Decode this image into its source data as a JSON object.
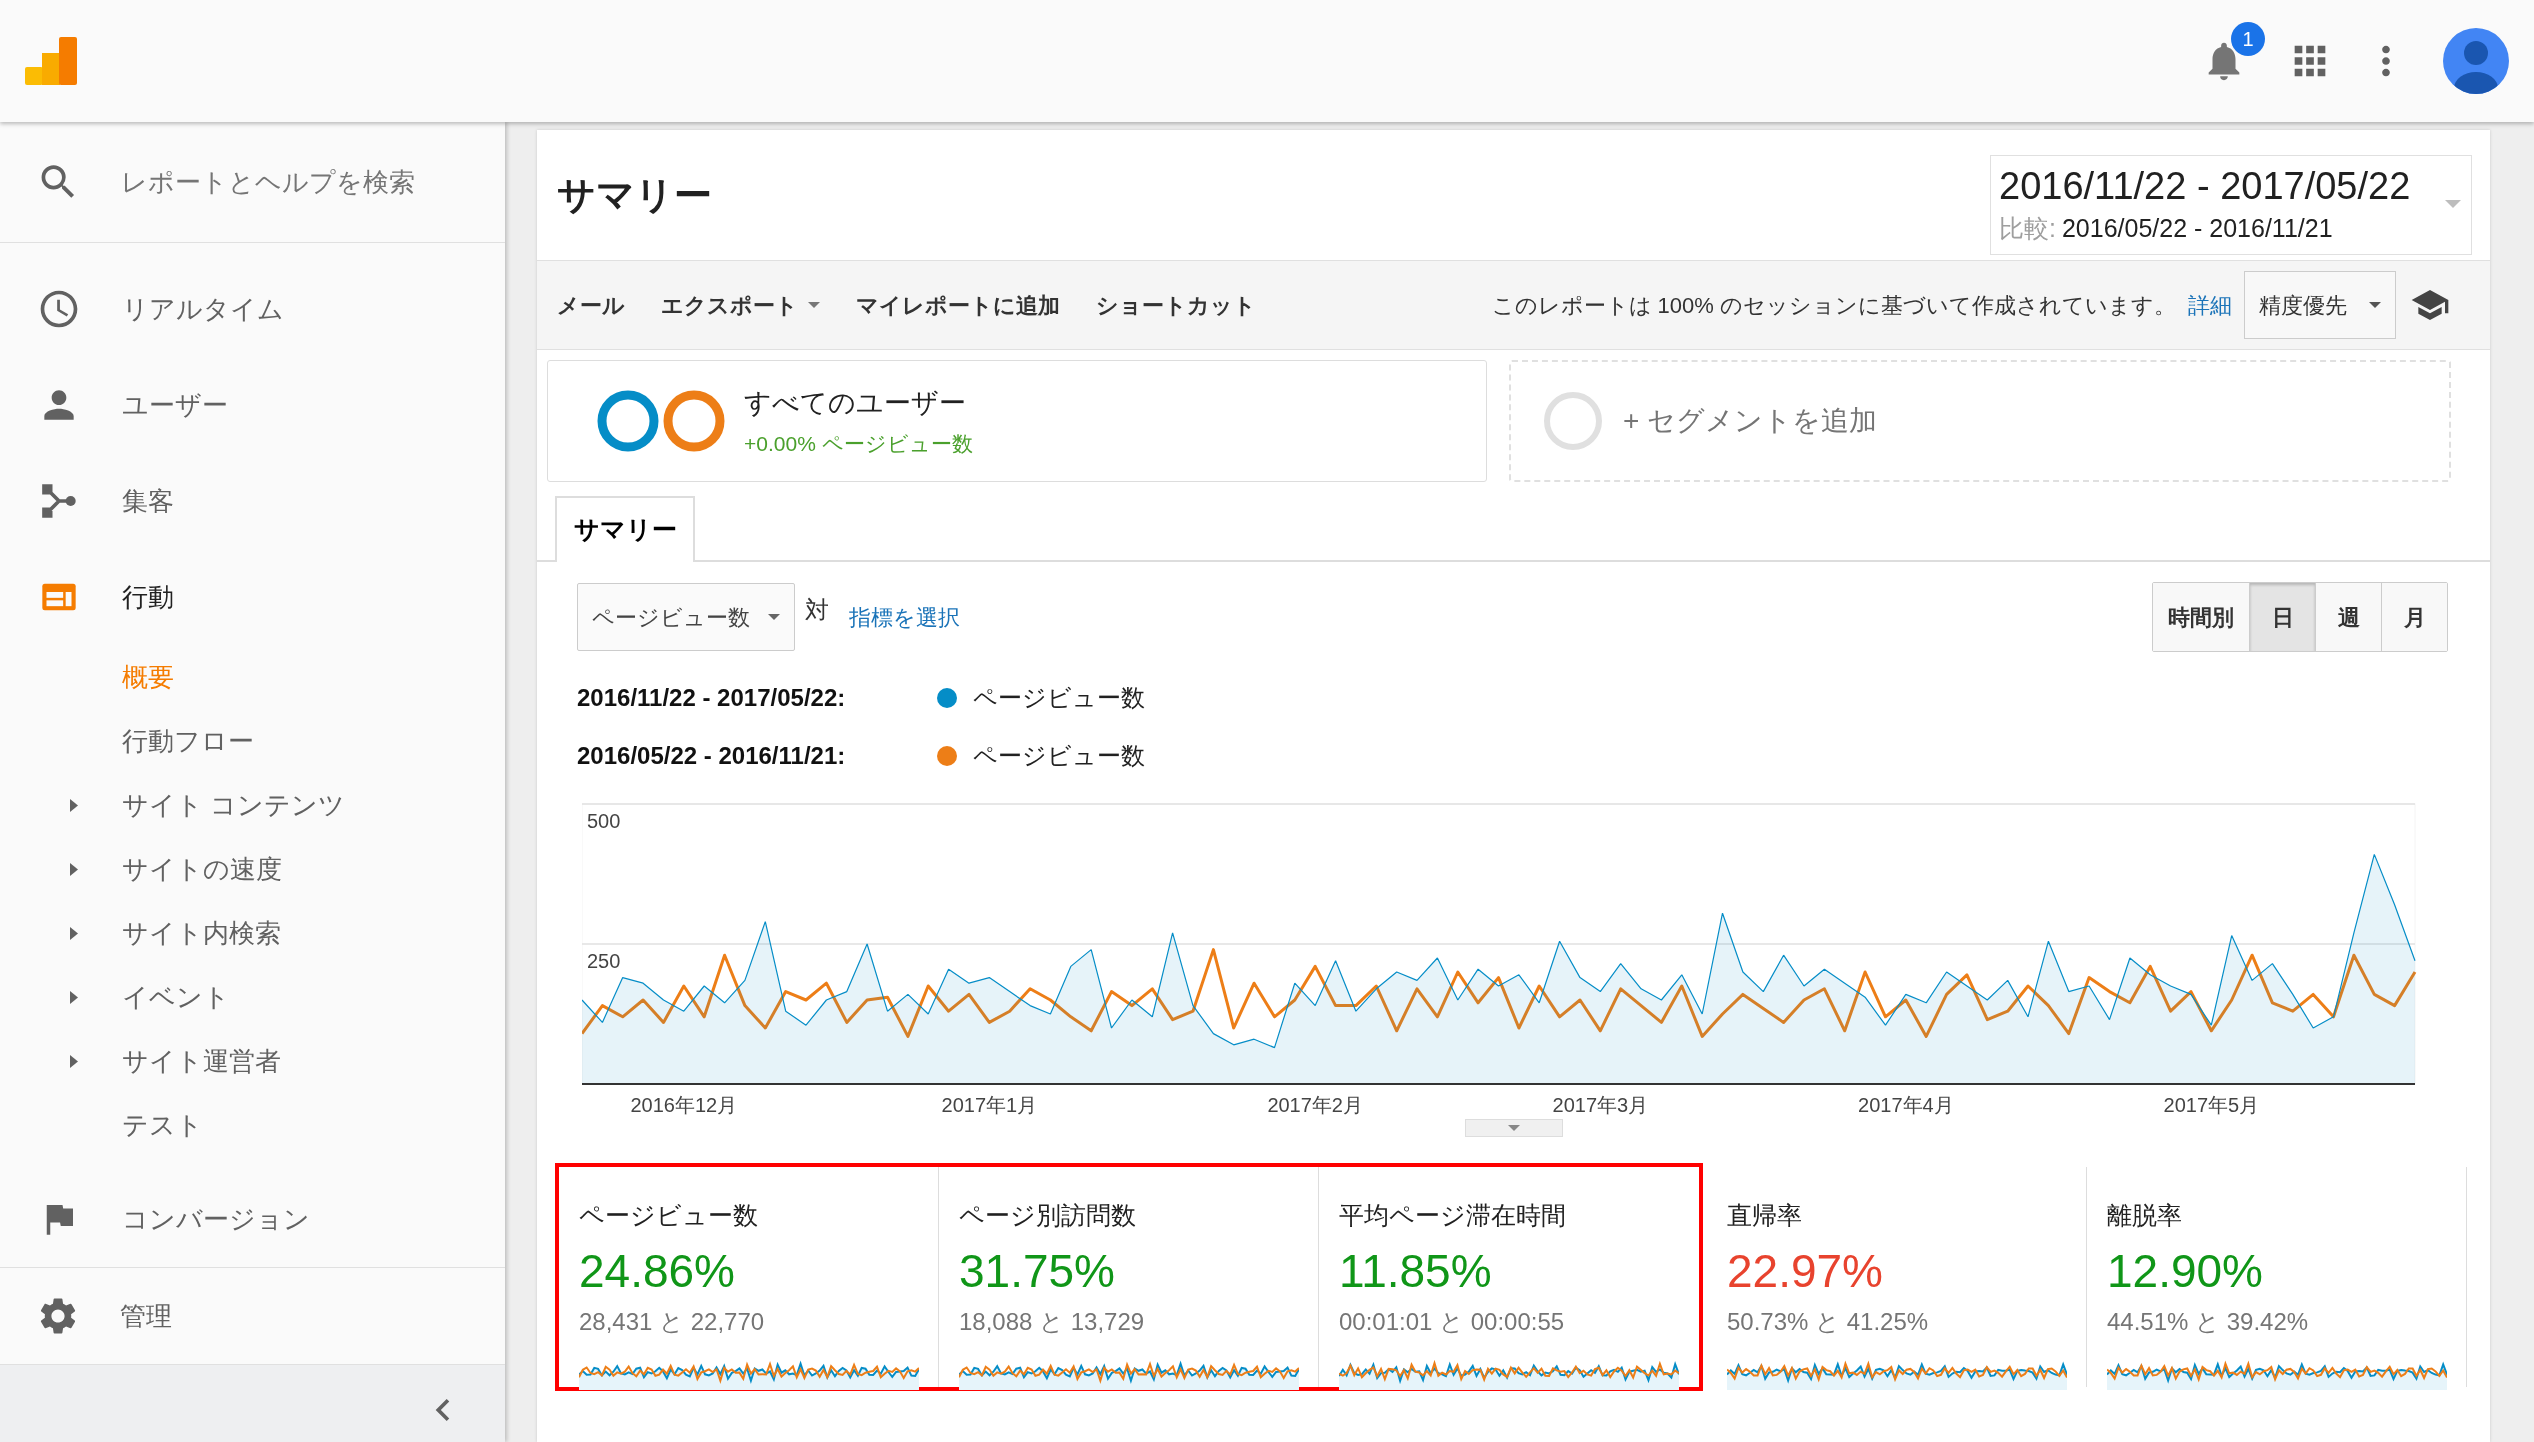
{
  "app_bar": {
    "notification_count": "1"
  },
  "sidebar": {
    "search": {
      "placeholder": "レポートとヘルプを検索"
    },
    "items": [
      {
        "label": "リアルタイム",
        "selected": false
      },
      {
        "label": "ユーザー",
        "selected": false
      },
      {
        "label": "集客",
        "selected": false
      },
      {
        "label": "行動",
        "selected": true,
        "children": [
          {
            "label": "概要",
            "selected": true,
            "expandable": false
          },
          {
            "label": "行動フロー",
            "selected": false,
            "expandable": false
          },
          {
            "label": "サイト コンテンツ",
            "selected": false,
            "expandable": true
          },
          {
            "label": "サイトの速度",
            "selected": false,
            "expandable": true
          },
          {
            "label": "サイト内検索",
            "selected": false,
            "expandable": true
          },
          {
            "label": "イベント",
            "selected": false,
            "expandable": true
          },
          {
            "label": "サイト運営者",
            "selected": false,
            "expandable": true
          },
          {
            "label": "テスト",
            "selected": false,
            "expandable": false
          }
        ]
      },
      {
        "label": "コンバージョン",
        "selected": false
      }
    ],
    "footer_item": {
      "label": "管理"
    }
  },
  "report": {
    "title": "サマリー",
    "date_range": "2016/11/22 - 2017/05/22",
    "compare_label": "比較:",
    "compare_range": "2016/05/22 - 2016/11/21"
  },
  "toolbar": {
    "actions": [
      {
        "label": "メール",
        "kind": "link"
      },
      {
        "label": "エクスポート",
        "kind": "dropdown"
      },
      {
        "label": "マイレポートに追加",
        "kind": "link"
      },
      {
        "label": "ショートカット",
        "kind": "link"
      }
    ],
    "notice": "このレポートは 100% のセッションに基づいて作成されています。",
    "notice_link": "詳細",
    "precision_select": "精度優先"
  },
  "segments": [
    {
      "kind": "segment",
      "name": "すべてのユーザー",
      "delta": "+0.00% ページビュー数"
    },
    {
      "kind": "add",
      "name": "+ セグメントを追加"
    }
  ],
  "tabs": [
    {
      "label": "サマリー",
      "selected": true
    }
  ],
  "chart_controls": {
    "metric": "ページビュー数",
    "versus": "対",
    "pick_metric": "指標を選択",
    "granularity": [
      {
        "label": "時間別",
        "selected": false
      },
      {
        "label": "日",
        "selected": true
      },
      {
        "label": "週",
        "selected": false
      },
      {
        "label": "月",
        "selected": false
      }
    ]
  },
  "legend": [
    {
      "metric": "ページビュー数"
    },
    {
      "metric": "ページビュー数"
    }
  ],
  "chart_data": {
    "type": "line",
    "ylim": [
      0,
      500
    ],
    "yticks": [
      250,
      500
    ],
    "categories": [
      null,
      null,
      null,
      null,
      null,
      "2016年12月",
      null,
      null,
      null,
      null,
      null,
      null,
      null,
      null,
      null,
      null,
      null,
      null,
      null,
      null,
      "2017年1月",
      null,
      null,
      null,
      null,
      null,
      null,
      null,
      null,
      null,
      null,
      null,
      null,
      null,
      null,
      null,
      "2017年2月",
      null,
      null,
      null,
      null,
      null,
      null,
      null,
      null,
      null,
      null,
      null,
      null,
      null,
      "2017年3月",
      null,
      null,
      null,
      null,
      null,
      null,
      null,
      null,
      null,
      null,
      null,
      null,
      null,
      null,
      "2017年4月",
      null,
      null,
      null,
      null,
      null,
      null,
      null,
      null,
      null,
      null,
      null,
      null,
      null,
      null,
      "2017年5月",
      null,
      null,
      null,
      null,
      null,
      null,
      null,
      null,
      null,
      null
    ],
    "series": [
      {
        "name": "2016/11/22 - 2017/05/22:",
        "type": "area",
        "color": "#058dc7",
        "values": [
          150,
          110,
          190,
          180,
          150,
          130,
          175,
          145,
          185,
          290,
          130,
          105,
          150,
          165,
          250,
          130,
          160,
          125,
          205,
          180,
          190,
          165,
          140,
          125,
          210,
          240,
          100,
          150,
          120,
          270,
          140,
          90,
          70,
          80,
          65,
          180,
          140,
          220,
          130,
          170,
          200,
          185,
          225,
          150,
          205,
          175,
          195,
          145,
          255,
          190,
          165,
          215,
          170,
          150,
          195,
          125,
          305,
          200,
          165,
          230,
          175,
          205,
          180,
          155,
          105,
          160,
          145,
          200,
          175,
          150,
          185,
          120,
          255,
          165,
          175,
          115,
          225,
          195,
          175,
          160,
          105,
          265,
          185,
          215,
          160,
          100,
          120,
          270,
          410,
          320,
          220
        ]
      },
      {
        "name": "2016/05/22 - 2016/11/21:",
        "type": "line",
        "color": "#ed7e17",
        "values": [
          90,
          140,
          120,
          150,
          110,
          175,
          120,
          230,
          140,
          100,
          165,
          150,
          180,
          110,
          150,
          155,
          85,
          175,
          130,
          160,
          110,
          130,
          170,
          150,
          120,
          95,
          165,
          140,
          170,
          115,
          130,
          240,
          100,
          180,
          120,
          150,
          210,
          140,
          140,
          175,
          95,
          170,
          120,
          200,
          145,
          190,
          100,
          175,
          120,
          150,
          95,
          170,
          140,
          110,
          175,
          85,
          125,
          160,
          135,
          110,
          150,
          170,
          95,
          200,
          120,
          150,
          85,
          160,
          195,
          115,
          130,
          175,
          140,
          90,
          190,
          165,
          145,
          210,
          130,
          165,
          95,
          150,
          230,
          145,
          130,
          160,
          120,
          230,
          160,
          140,
          200
        ]
      }
    ]
  },
  "metrics": [
    {
      "label": "ページビュー数",
      "value": "24.86%",
      "comparison": "28,431 と 22,770",
      "color": "#109618",
      "highlighted": true
    },
    {
      "label": "ページ別訪問数",
      "value": "31.75%",
      "comparison": "18,088 と 13,729",
      "color": "#109618",
      "highlighted": true
    },
    {
      "label": "平均ページ滞在時間",
      "value": "11.85%",
      "comparison": "00:01:01 と 00:00:55",
      "color": "#109618",
      "highlighted": true
    },
    {
      "label": "直帰率",
      "value": "22.97%",
      "comparison": "50.73% と 41.25%",
      "color": "#e8432e",
      "highlighted": false
    },
    {
      "label": "離脱率",
      "value": "12.90%",
      "comparison": "44.51% と 39.42%",
      "color": "#109618",
      "highlighted": false
    }
  ]
}
